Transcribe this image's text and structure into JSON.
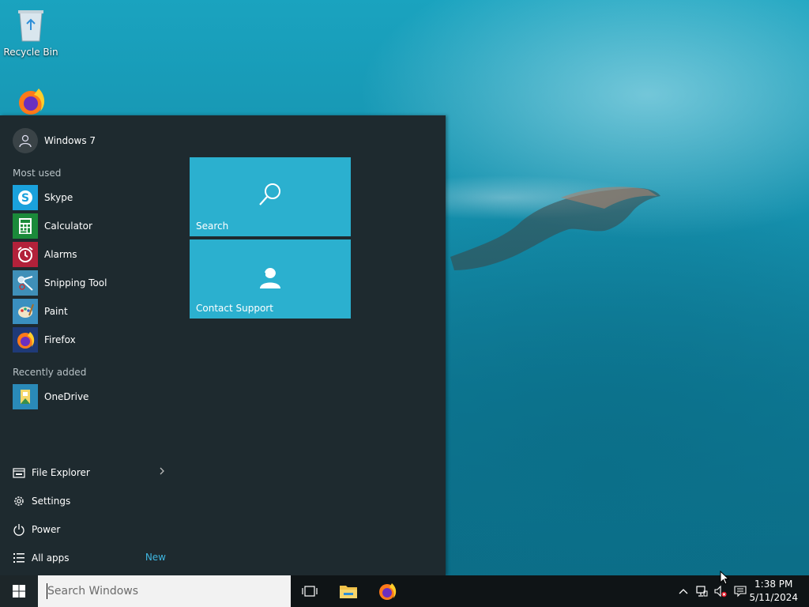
{
  "desktop": {
    "icons": [
      {
        "label": "Recycle Bin",
        "icon": "recycle-bin-icon"
      },
      {
        "label": "",
        "icon": "firefox-icon"
      }
    ]
  },
  "start_menu": {
    "user": {
      "name": "Windows 7",
      "icon": "user-avatar-icon"
    },
    "most_used_label": "Most used",
    "most_used": [
      {
        "label": "Skype",
        "icon": "skype-icon",
        "color": "#1aa1dc"
      },
      {
        "label": "Calculator",
        "icon": "calculator-icon",
        "color": "#1b8a3a"
      },
      {
        "label": "Alarms",
        "icon": "alarm-clock-icon",
        "color": "#b2213a"
      },
      {
        "label": "Snipping Tool",
        "icon": "snipping-tool-icon",
        "color": "#3f8fb8"
      },
      {
        "label": "Paint",
        "icon": "paint-icon",
        "color": "#3a8fc0"
      },
      {
        "label": "Firefox",
        "icon": "firefox-icon",
        "color": "#1f3a78"
      }
    ],
    "recently_added_label": "Recently added",
    "recently_added": [
      {
        "label": "OneDrive",
        "icon": "onedrive-icon",
        "color": "#2a8ab8"
      }
    ],
    "bottom": {
      "file_explorer": "File Explorer",
      "settings": "Settings",
      "power": "Power",
      "all_apps": "All apps",
      "all_apps_badge": "New"
    },
    "tiles": [
      {
        "label": "Search",
        "icon": "search-icon",
        "color": "#2bb0cf"
      },
      {
        "label": "Contact Support",
        "icon": "contact-support-icon",
        "color": "#2bb0cf"
      }
    ]
  },
  "taskbar": {
    "search_placeholder": "Search Windows",
    "pinned": [
      "task-view-icon",
      "file-explorer-icon",
      "firefox-icon"
    ],
    "tray": [
      "chevron-up-icon",
      "network-icon",
      "volume-muted-icon",
      "action-center-icon"
    ],
    "time": "1:38 PM",
    "date": "5/11/2024"
  }
}
